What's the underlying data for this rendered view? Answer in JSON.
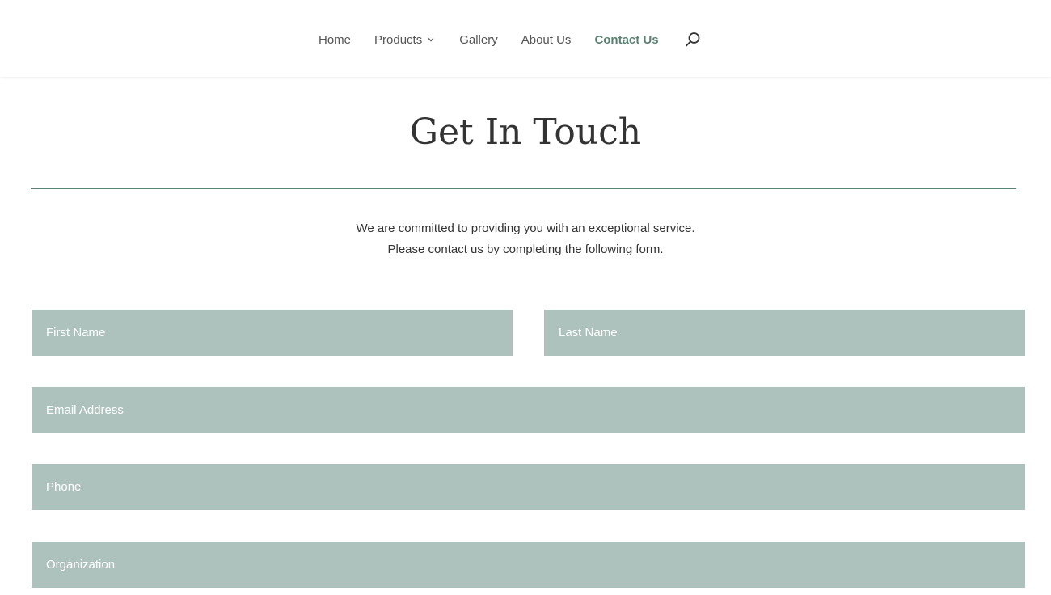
{
  "nav": {
    "items": [
      {
        "label": "Home"
      },
      {
        "label": "Products"
      },
      {
        "label": "Gallery"
      },
      {
        "label": "About Us"
      },
      {
        "label": "Contact Us"
      }
    ],
    "active": "Contact Us",
    "search_icon": "search-icon"
  },
  "page": {
    "title": "Get In Touch",
    "intro_line1": "We are committed to providing you with an exceptional service.",
    "intro_line2": "Please contact us by completing the following form."
  },
  "form": {
    "first_name_placeholder": "First Name",
    "last_name_placeholder": "Last Name",
    "email_placeholder": "Email Address",
    "phone_placeholder": "Phone",
    "organization_placeholder": "Organization",
    "first_name_value": "",
    "last_name_value": "",
    "email_value": "",
    "phone_value": "",
    "organization_value": ""
  },
  "colors": {
    "accent": "#5c8273",
    "field_bg": "#aec2bd",
    "text": "#333333",
    "nav_text": "#555555"
  }
}
